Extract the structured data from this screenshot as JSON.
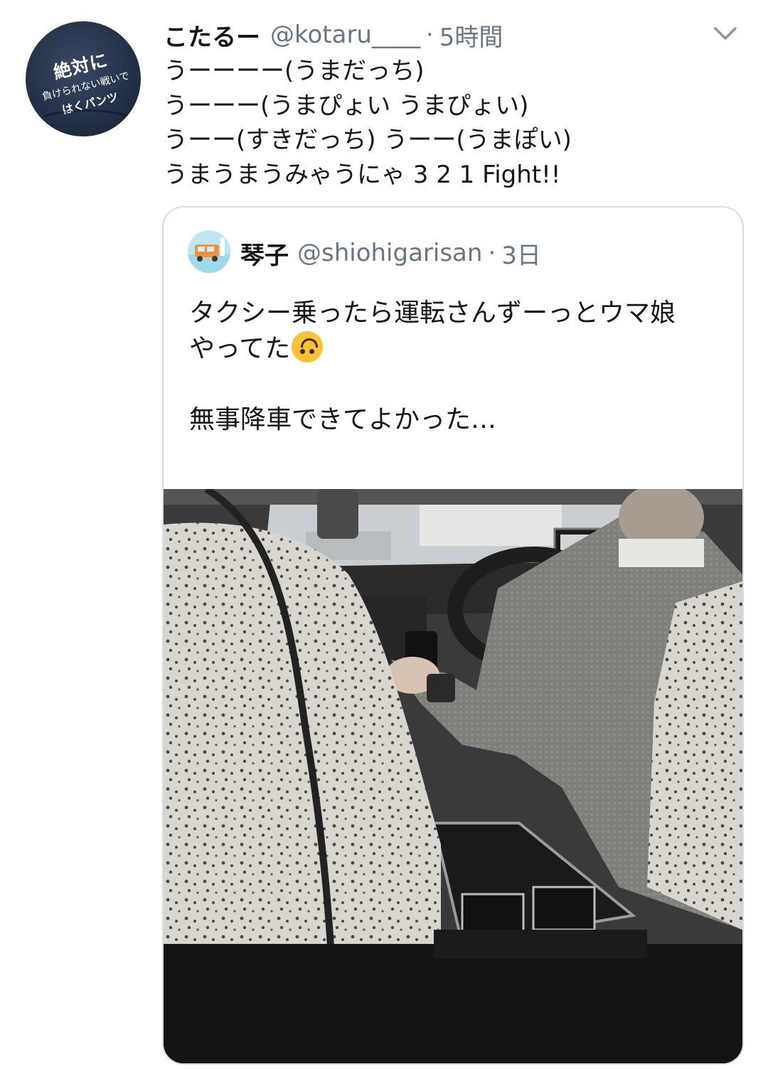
{
  "tweet": {
    "display_name": "こたるー",
    "handle": "@kotaru____",
    "separator": "·",
    "time": "5時間",
    "lines": [
      "うーーーー(うまだっち)",
      "うーーー(うまぴょい うまぴょい)",
      "うーー(すきだっち) うーー(うまぽい)",
      "うまうまうみゃうにゃ 3 2 1 Fight!!"
    ],
    "avatar": {
      "line1": "絶対に",
      "line2": "負けられない戦いで",
      "line3": "はくパンツ"
    }
  },
  "quoted": {
    "display_name": "琴子",
    "handle": "@shiohigarisan",
    "separator": "·",
    "time": "3日",
    "line1": "タクシー乗ったら運転さんずーっとウマ娘",
    "line2": "やってた",
    "line3": "",
    "line4": "無事降車できてよかった…",
    "ellipsis": "…"
  },
  "icons": {
    "menu": "chevron-down-icon",
    "emoji": "upside-down-face-emoji"
  },
  "colors": {
    "secondary_text": "#657786",
    "border": "#d7dde3"
  }
}
